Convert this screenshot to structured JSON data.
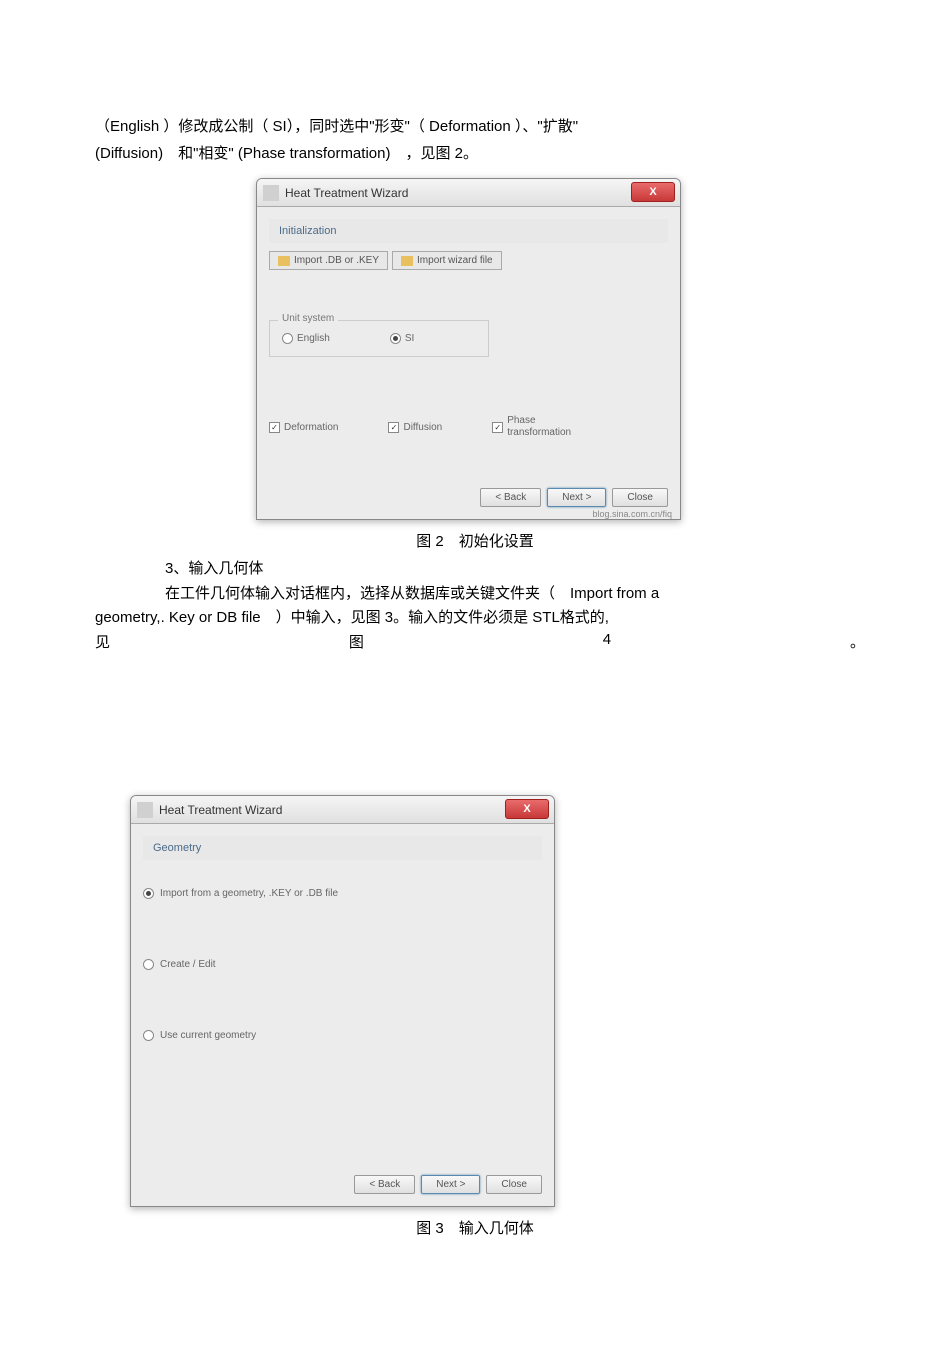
{
  "intro": {
    "line1": "（English ）修改成公制（ SI），同时选中\"形变\"（ Deformation ）、\"扩散\"",
    "line2": "(Diffusion)　和\"相变\" (Phase transformation)　，见图 2。"
  },
  "wizard1": {
    "title": "Heat Treatment Wizard",
    "step": "Initialization",
    "import_db": "Import .DB or .KEY",
    "import_wiz": "Import wizard file",
    "unit_legend": "Unit system",
    "unit_english": "English",
    "unit_si": "SI",
    "deformation": "Deformation",
    "diffusion": "Diffusion",
    "phase": "Phase\ntransformation",
    "back": "< Back",
    "next": "Next >",
    "close": "Close",
    "watermark": "blog.sina.com.cn/fiq"
  },
  "caption1": "图 2　初始化设置",
  "section3": "3、输入几何体",
  "para1": "在工件几何体输入对话框内，选择从数据库或关键文件夹（　Import from a",
  "para2": "geometry,. Key or DB file　）中输入，见图 3。输入的文件必须是 STL格式的,",
  "para3_a": "见",
  "para3_b": "图",
  "para3_c": "4",
  "para3_d": "。",
  "wizard2": {
    "title": "Heat Treatment Wizard",
    "step": "Geometry",
    "opt1": "Import from a geometry, .KEY or .DB file",
    "opt2": "Create / Edit",
    "opt3": "Use current geometry",
    "back": "< Back",
    "next": "Next >",
    "close": "Close"
  },
  "caption2": "图 3　输入几何体"
}
